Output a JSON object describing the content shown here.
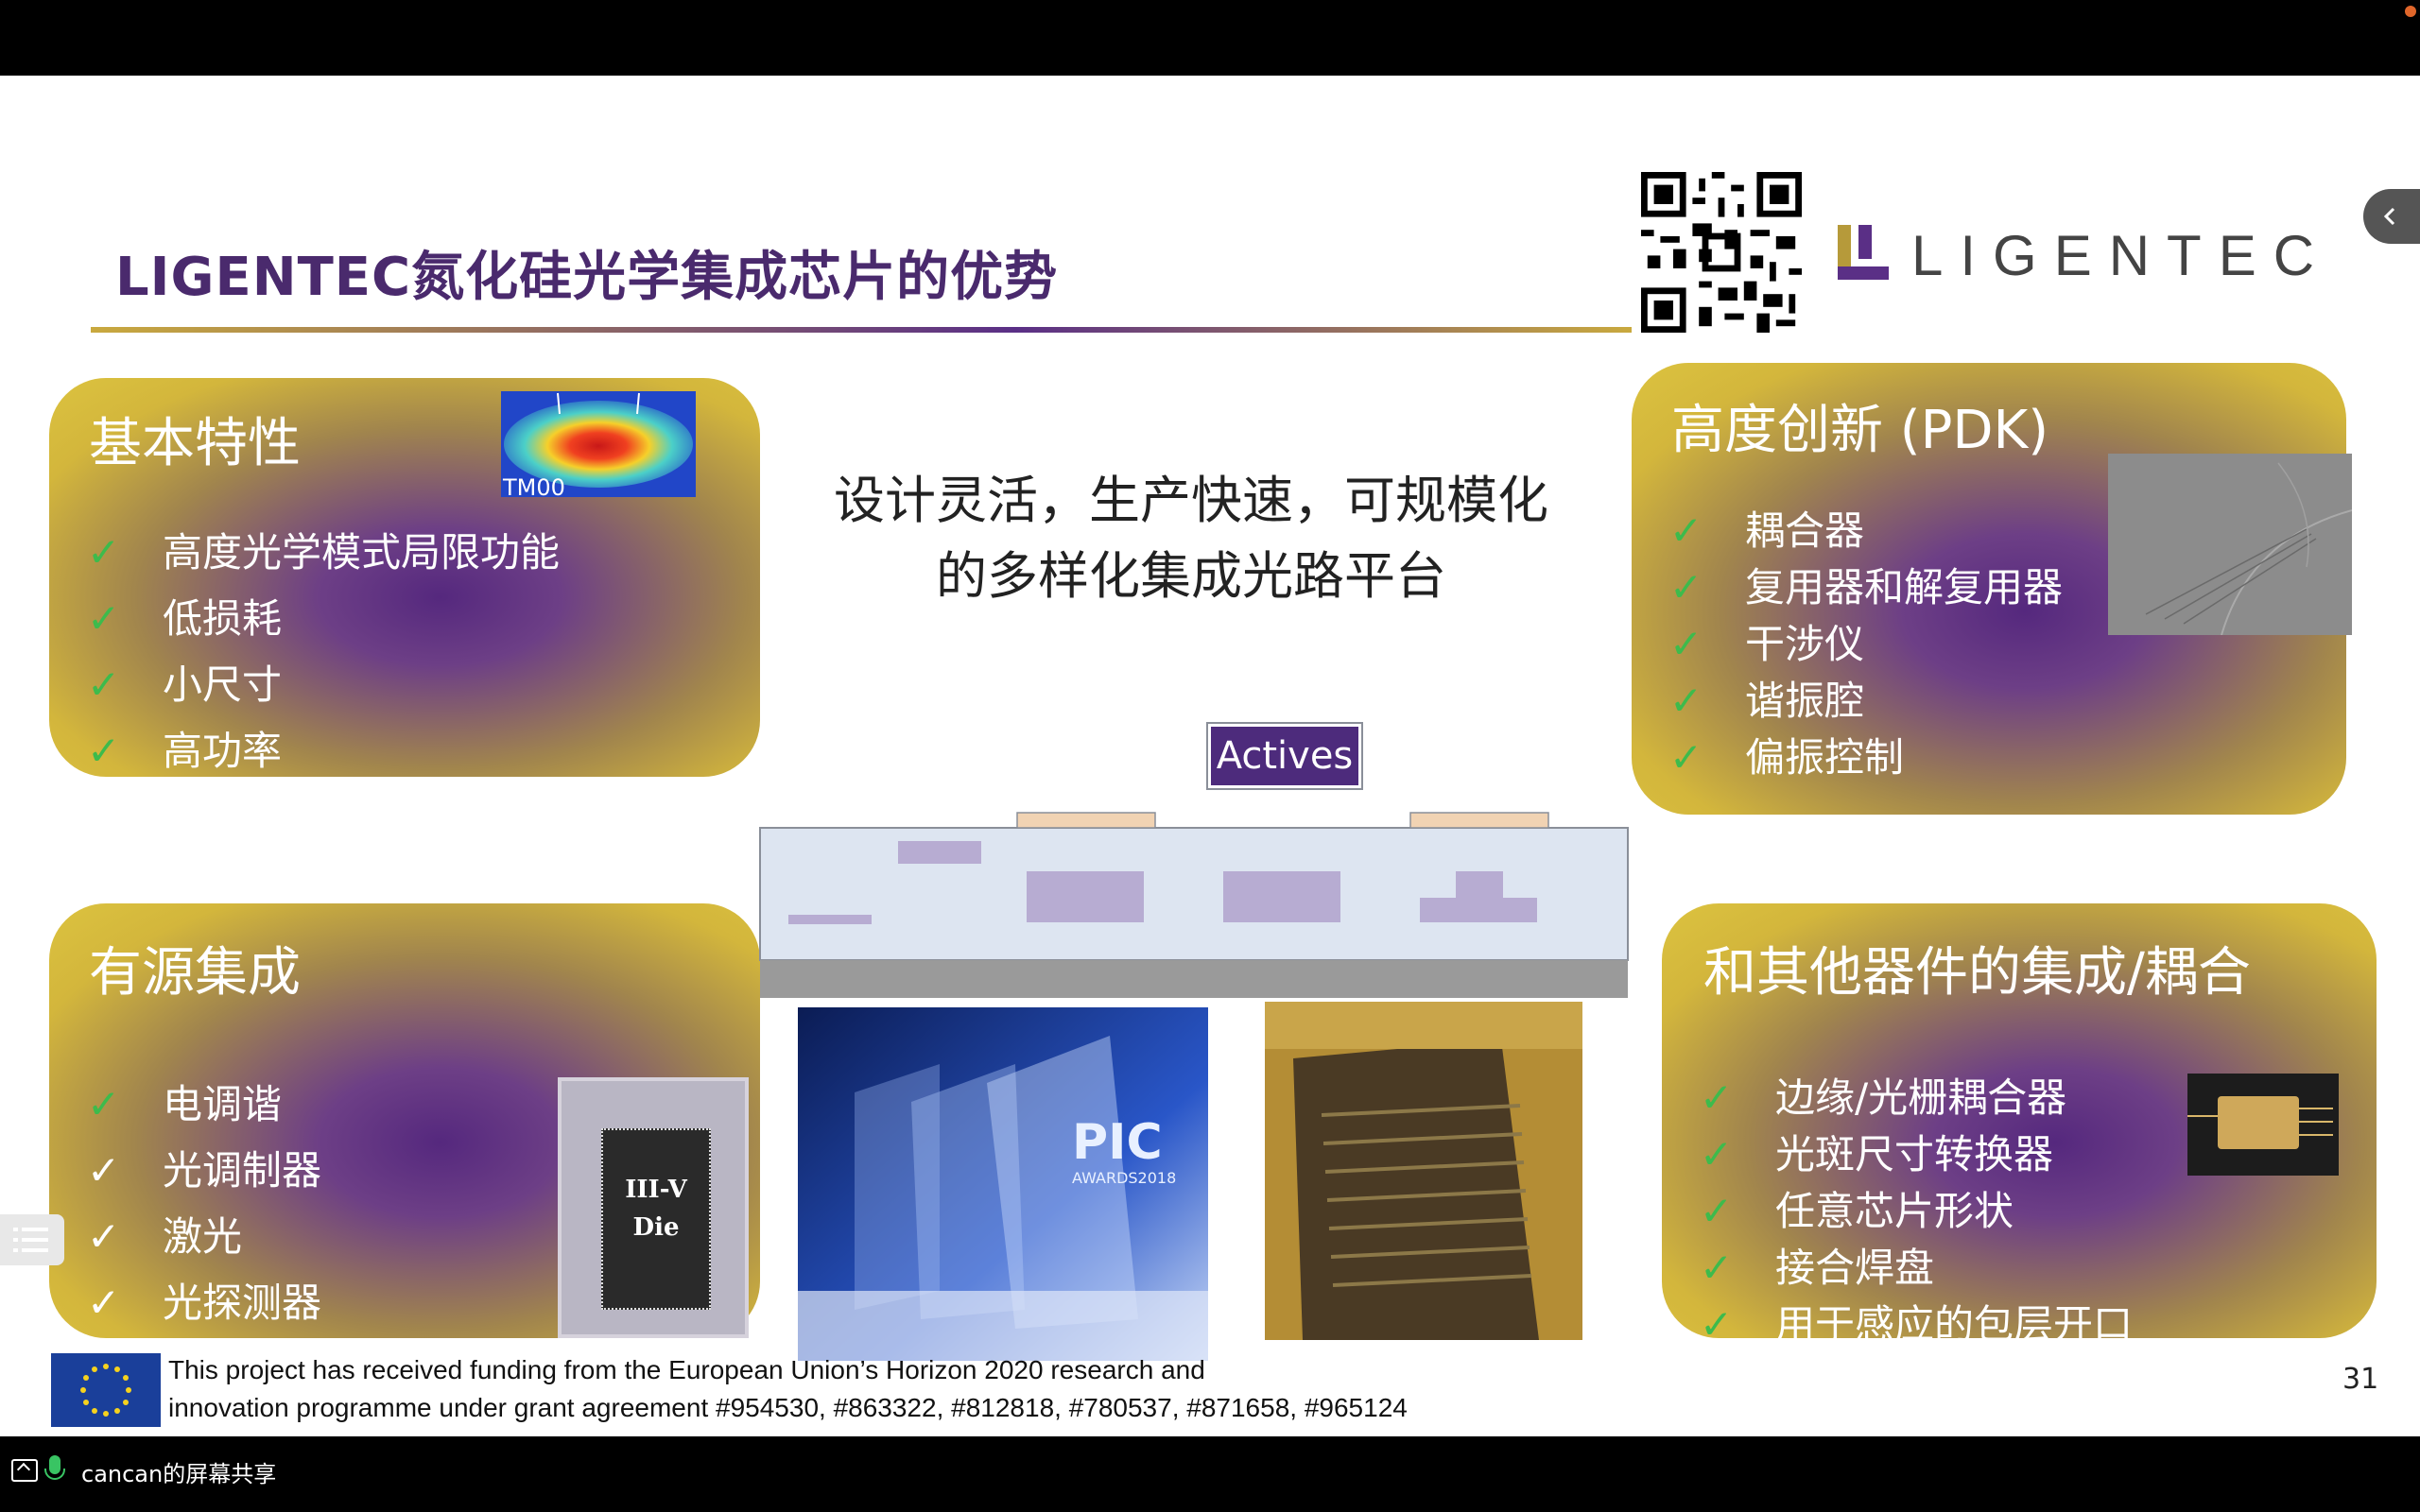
{
  "slide": {
    "title": "LIGENTEC氮化硅光学集成芯片的优势",
    "logo_text": "LIGENTEC",
    "headline_line1": "设计灵活，生产快速，可规模化",
    "headline_line2": "的多样化集成光路平台",
    "actives_label": "Actives",
    "tm00_label": "TM00",
    "die_label_line1": "III-V",
    "die_label_line2": "Die",
    "award_text": "PIC",
    "award_year": "AWARDS2018",
    "panels": {
      "basic": {
        "title": "基本特性",
        "items": [
          "高度光学模式局限功能",
          "低损耗",
          "小尺寸",
          "高功率"
        ]
      },
      "innovation": {
        "title": "高度创新 (PDK)",
        "items": [
          "耦合器",
          "复用器和解复用器",
          "干涉仪",
          "谐振腔",
          "偏振控制"
        ]
      },
      "active": {
        "title": "有源集成",
        "items": [
          "电调谐",
          "光调制器",
          "激光",
          "光探测器"
        ]
      },
      "integration": {
        "title": "和其他器件的集成/耦合",
        "items": [
          "边缘/光栅耦合器",
          "光斑尺寸转换器",
          "任意芯片形状",
          "接合焊盘",
          "用于感应的包层开口"
        ]
      }
    },
    "check": "✓",
    "footer_line1": "This project has received funding from the European Union’s Horizon 2020 research and",
    "footer_line2": "innovation programme under grant agreement #954530, #863322, #812818, #780537, #871658, #965124",
    "page_number": "31"
  },
  "bottom_bar": {
    "share_text": "cancan的屏幕共享"
  },
  "colors": {
    "title": "#4a2a6d",
    "check": "#3dbb4c",
    "gold": "#d3b63c",
    "purple": "#55287e"
  }
}
